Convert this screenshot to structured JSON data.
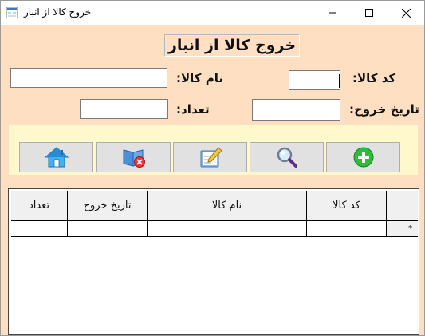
{
  "window": {
    "title": "خروج کالا از انبار"
  },
  "form": {
    "heading": "خروج کالا از انبار",
    "code_label": "کد کالا:",
    "name_label": "نام کالا:",
    "date_label": "تاریخ خروج:",
    "qty_label": "تعداد:",
    "code_value": "",
    "name_value": "",
    "date_value": "",
    "qty_value": ""
  },
  "toolbar": {
    "buttons": [
      {
        "icon": "home-icon"
      },
      {
        "icon": "delete-book-icon"
      },
      {
        "icon": "edit-icon"
      },
      {
        "icon": "search-icon"
      },
      {
        "icon": "add-icon"
      }
    ]
  },
  "grid": {
    "columns": [
      "کد کالا",
      "نام کالا",
      "تاریخ خروج",
      "تعداد"
    ],
    "new_row_marker": "*"
  },
  "colors": {
    "form_background": "#ffdfc2",
    "toolbar_panel": "#fff8cc",
    "button_face": "#e1e1e1",
    "add_green": "#2ebd3a"
  }
}
